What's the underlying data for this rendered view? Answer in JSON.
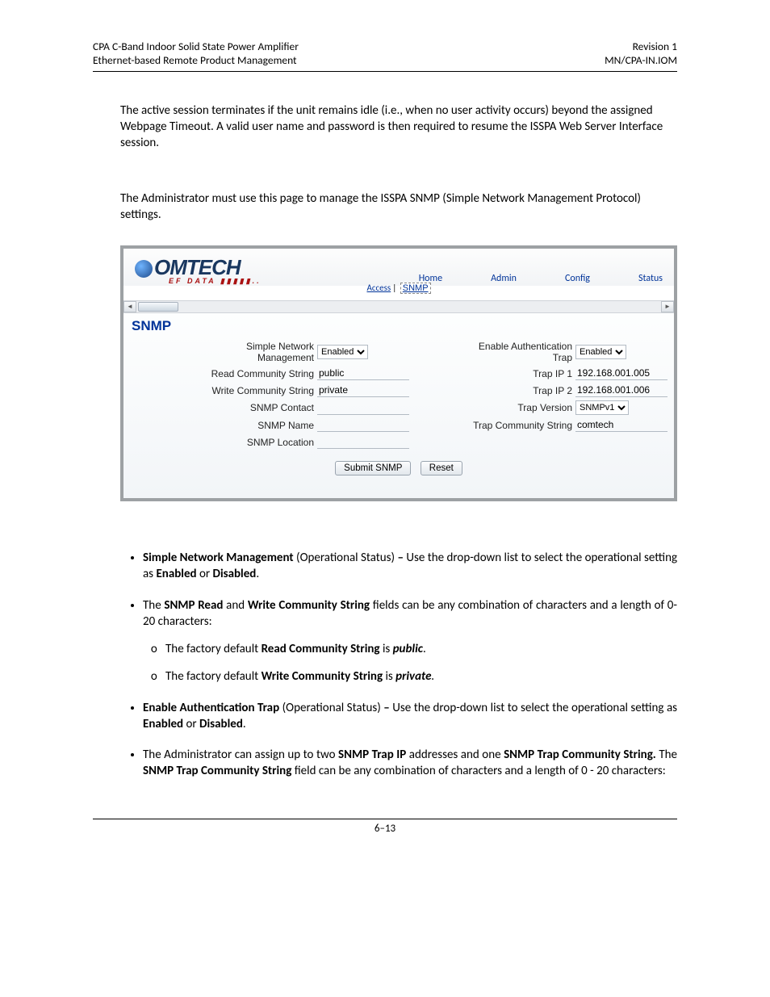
{
  "header": {
    "left1": "CPA C-Band Indoor Solid State Power Amplifier",
    "left2": "Ethernet-based Remote Product Management",
    "right1": "Revision 1",
    "right2": "MN/CPA-IN.IOM"
  },
  "para1": "The active session terminates if the unit remains idle (i.e., when no user activity occurs) beyond the assigned Webpage Timeout. A valid user name and password is then required to resume the ISSPA Web Server Interface session.",
  "para2": "The Administrator must use this page to manage the ISSPA SNMP (Simple Network Management Protocol) settings.",
  "screenshot": {
    "logo_main": "OMTECH",
    "logo_sub": "EF DATA ▮▮▮▮▮..",
    "tabs": [
      "Home",
      "Admin",
      "Config",
      "Status"
    ],
    "subtab_access": "Access",
    "subtab_snmp": "SNMP",
    "pane_title": "SNMP",
    "labels": {
      "snm": "Simple Network\nManagement",
      "rcs": "Read Community String",
      "wcs": "Write Community String",
      "contact": "SNMP Contact",
      "name": "SNMP Name",
      "location": "SNMP Location",
      "eat": "Enable Authentication\nTrap",
      "tip1": "Trap IP 1",
      "tip2": "Trap IP 2",
      "tver": "Trap Version",
      "tcs": "Trap Community String"
    },
    "values": {
      "snm": "Enabled",
      "rcs": "public",
      "wcs": "private",
      "contact": "",
      "name": "",
      "location": "",
      "eat": "Enabled",
      "tip1": "192.168.001.005",
      "tip2": "192.168.001.006",
      "tver": "SNMPv1",
      "tcs": "comtech"
    },
    "submit": "Submit SNMP",
    "reset": "Reset"
  },
  "bullets": {
    "b1a": "Simple Network Management",
    "b1b": " (Operational Status) ",
    "b1c": "–",
    "b1d": " Use the drop-down list to select the operational setting as ",
    "b1e": "Enabled",
    "b1f": " or ",
    "b1g": "Disabled",
    "b2a": "The ",
    "b2b": "SNMP Read",
    "b2c": " and ",
    "b2d": "Write Community String",
    "b2e": " fields can be any combination of characters and a length of 0-20 characters:",
    "b2s1a": "The factory default ",
    "b2s1b": "Read Community String",
    "b2s1c": " is ",
    "b2s1d": "public",
    "b2s2a": "The factory default ",
    "b2s2b": "Write Community String",
    "b2s2c": " is ",
    "b2s2d": "private",
    "b3a": "Enable Authentication Trap",
    "b3b": " (Operational Status) ",
    "b3c": "–",
    "b3d": " Use the drop-down list to select the operational setting as ",
    "b3e": "Enabled",
    "b3f": " or ",
    "b3g": "Disabled",
    "b4a": "The Administrator can assign up to two ",
    "b4b": "SNMP Trap IP",
    "b4c": " addresses and one ",
    "b4d": "SNMP Trap Community String.",
    "b4e": " The ",
    "b4f": "SNMP Trap Community String",
    "b4g": " field can be any combination of characters and a length of 0 - 20 characters:"
  },
  "footer": "6–13"
}
